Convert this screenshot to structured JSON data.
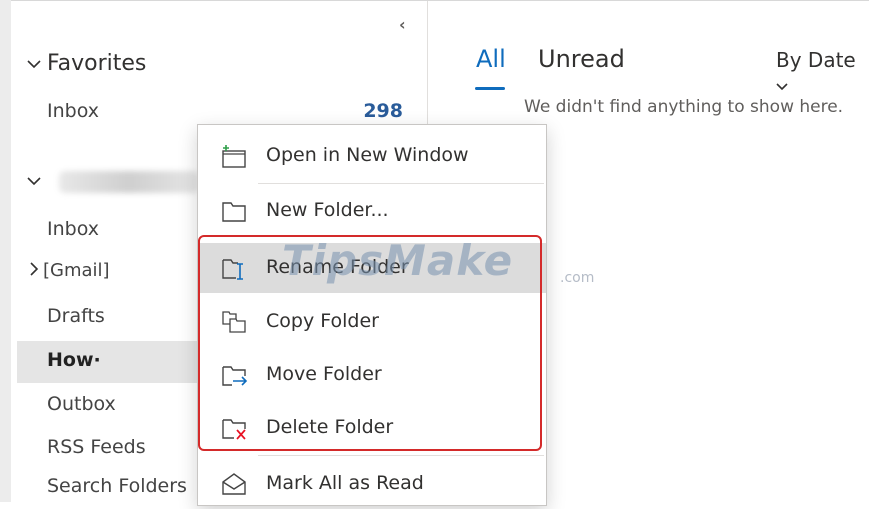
{
  "favorites": {
    "heading": "Favorites",
    "inbox_label": "Inbox",
    "inbox_count": "298"
  },
  "account": {
    "folders": [
      "Inbox",
      "[Gmail]",
      "Drafts",
      "How·",
      "Outbox",
      "RSS Feeds",
      "Search Folders"
    ]
  },
  "message_list": {
    "tab_all": "All",
    "tab_unread": "Unread",
    "sort_label": "By Date",
    "empty_text": "We didn't find anything to show here."
  },
  "context_menu": {
    "items": [
      {
        "label": "Open in New Window"
      },
      {
        "label": "New Folder..."
      },
      {
        "label": "Rename Folder"
      },
      {
        "label": "Copy Folder"
      },
      {
        "label": "Move Folder"
      },
      {
        "label": "Delete Folder"
      },
      {
        "label": "Mark All as Read"
      }
    ]
  },
  "watermark": {
    "main": "TipsMake",
    "suffix": ".com"
  },
  "colors": {
    "accent": "#0f6cbd",
    "highlight_box": "#d42a2a",
    "count": "#2a5c9a",
    "delete_x": "#e81123",
    "move_arrow": "#0f6cbd"
  }
}
